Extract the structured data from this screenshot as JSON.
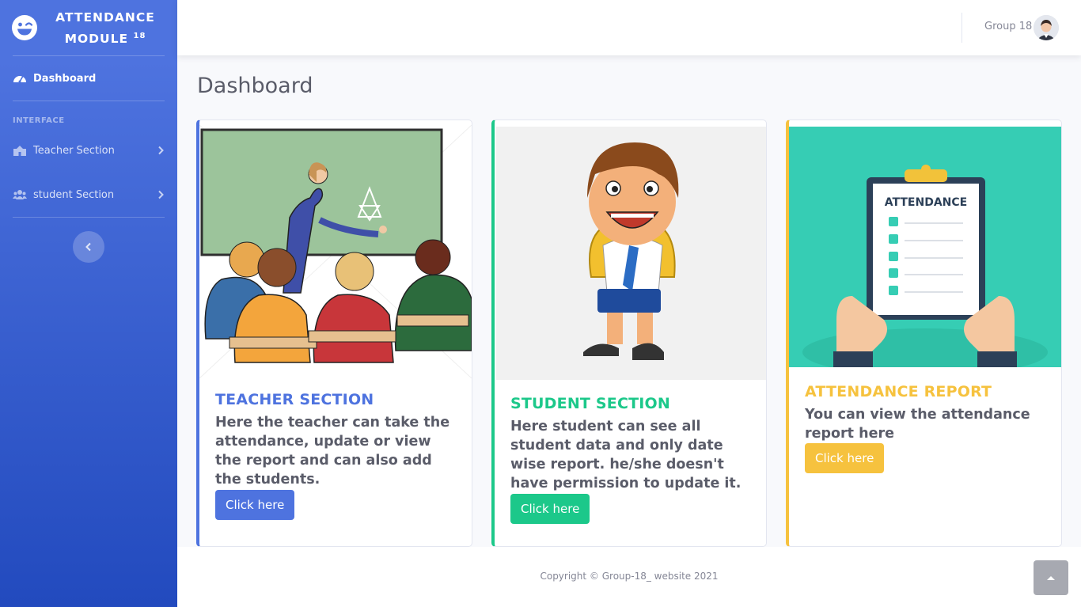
{
  "brand": {
    "title_line1": "ATTENDANCE",
    "title_line2": "MODULE",
    "title_sup": "18"
  },
  "sidebar": {
    "dashboard_label": "Dashboard",
    "heading": "INTERFACE",
    "items": [
      {
        "label": "Teacher Section"
      },
      {
        "label": "student Section"
      }
    ]
  },
  "topbar": {
    "user_name": "Group 18"
  },
  "page": {
    "title": "Dashboard"
  },
  "cards": [
    {
      "title": "TEACHER SECTION",
      "text": "Here the teacher can take the attendance, update or view the report and can also add the students.",
      "button": "Click here",
      "color": "#4e73df"
    },
    {
      "title": "STUDENT SECTION",
      "text": "Here student can see all student data and only date wise report. he/she doesn't have permission to update it.",
      "button": "Click here",
      "color": "#1cc88a"
    },
    {
      "title": "ATTENDANCE REPORT",
      "text": "You can view the attendance report here",
      "button": "Click here",
      "color": "#f6c23e",
      "clipboard_title": "ATTENDANCE"
    }
  ],
  "footer": {
    "copyright": "Copyright © Group-18_ website 2021"
  },
  "icons": {
    "brand": "laugh-wink-icon",
    "dashboard": "tachometer-icon",
    "teacher": "school-icon",
    "student": "users-icon",
    "chevron": "chevron-right-icon",
    "toggle": "chevron-left-icon",
    "scroll_top": "angle-up-icon"
  }
}
